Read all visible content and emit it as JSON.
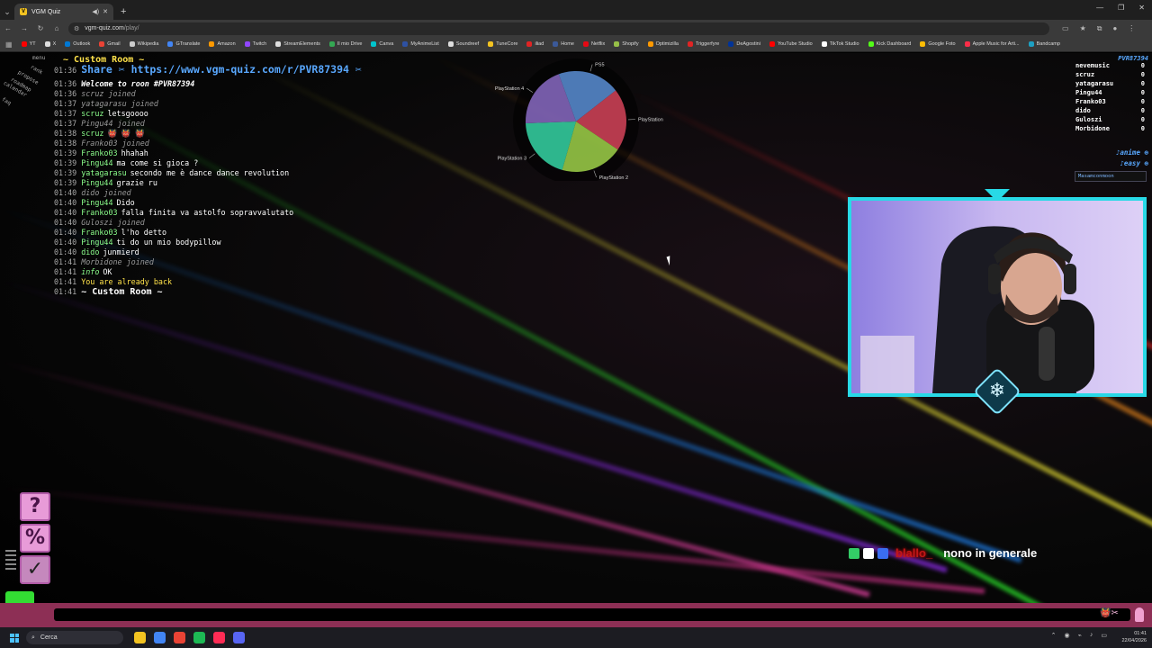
{
  "browser": {
    "tab_title": "VGM Quiz",
    "url_host": "vgm-quiz.com",
    "url_path": "/play/",
    "bookmarks": [
      {
        "label": "YT",
        "color": "#ff0000"
      },
      {
        "label": "X",
        "color": "#dddddd"
      },
      {
        "label": "Outlook",
        "color": "#0078d4"
      },
      {
        "label": "Gmail",
        "color": "#ea4335"
      },
      {
        "label": "Wikipedia",
        "color": "#cccccc"
      },
      {
        "label": "GTranslate",
        "color": "#4285f4"
      },
      {
        "label": "Amazon",
        "color": "#ff9900"
      },
      {
        "label": "Twitch",
        "color": "#9146ff"
      },
      {
        "label": "StreamElements",
        "color": "#dddddd"
      },
      {
        "label": "Il mio Drive",
        "color": "#34a853"
      },
      {
        "label": "Canva",
        "color": "#00c4cc"
      },
      {
        "label": "MyAnimeList",
        "color": "#2e51a2"
      },
      {
        "label": "Soundreef",
        "color": "#dddddd"
      },
      {
        "label": "TuneCore",
        "color": "#f3c321"
      },
      {
        "label": "iliad",
        "color": "#e02424"
      },
      {
        "label": "Home",
        "color": "#3b5998"
      },
      {
        "label": "Netflix",
        "color": "#e50914"
      },
      {
        "label": "Shopify",
        "color": "#96bf48"
      },
      {
        "label": "Optimizilla",
        "color": "#ff9900"
      },
      {
        "label": "Triggerfyre",
        "color": "#e02424"
      },
      {
        "label": "DeAgostini",
        "color": "#003399"
      },
      {
        "label": "YouTube Studio",
        "color": "#ff0000"
      },
      {
        "label": "TikTok Studio",
        "color": "#ffffff"
      },
      {
        "label": "Kick Dashboard",
        "color": "#53fc18"
      },
      {
        "label": "Google Foto",
        "color": "#fbbc05"
      },
      {
        "label": "Apple Music for Arti...",
        "color": "#fa2d48"
      },
      {
        "label": "Bandcamp",
        "color": "#1da0c3"
      }
    ]
  },
  "sidebar_rot": [
    "menu",
    "rank",
    "propose",
    "roadmap",
    "calendar",
    "faq"
  ],
  "chat": {
    "header": "~ Custom Room ~",
    "share_time": "01:36",
    "share_text": "Share ✂ https://www.vgm-quiz.com/r/PVR87394 ✂",
    "lines": [
      {
        "time": "01:36",
        "kind": "welcome",
        "user": "",
        "text": "Welcome to roon #PVR87394"
      },
      {
        "time": "01:36",
        "kind": "joined",
        "user": "",
        "text": "scruz joined"
      },
      {
        "time": "01:37",
        "kind": "joined",
        "user": "",
        "text": "yatagarasu joined"
      },
      {
        "time": "01:37",
        "kind": "msg",
        "user": "scruz",
        "text": "letsgoooo"
      },
      {
        "time": "01:37",
        "kind": "joined",
        "user": "",
        "text": "Pingu44 joined"
      },
      {
        "time": "01:38",
        "kind": "msg",
        "user": "scruz",
        "text": "👹 👹 👹"
      },
      {
        "time": "01:38",
        "kind": "joined",
        "user": "",
        "text": "Franko03 joined"
      },
      {
        "time": "01:39",
        "kind": "msg",
        "user": "Franko03",
        "text": "hhahah"
      },
      {
        "time": "01:39",
        "kind": "msg",
        "user": "Pingu44",
        "text": "ma come si gioca ?"
      },
      {
        "time": "01:39",
        "kind": "msg",
        "user": "yatagarasu",
        "text": "secondo me è dance dance revolution"
      },
      {
        "time": "01:39",
        "kind": "msg",
        "user": "Pingu44",
        "text": "grazie ru"
      },
      {
        "time": "01:40",
        "kind": "joined",
        "user": "",
        "text": "dido joined"
      },
      {
        "time": "01:40",
        "kind": "msg",
        "user": "Pingu44",
        "text": "Dido"
      },
      {
        "time": "01:40",
        "kind": "msg",
        "user": "Franko03",
        "text": "falla finita va astolfo sopravvalutato"
      },
      {
        "time": "01:40",
        "kind": "joined",
        "user": "",
        "text": "Guloszi joined"
      },
      {
        "time": "01:40",
        "kind": "msg",
        "user": "Franko03",
        "text": "l'ho detto"
      },
      {
        "time": "01:40",
        "kind": "msg",
        "user": "Pingu44",
        "text": "ti do un mio bodypillow"
      },
      {
        "time": "01:40",
        "kind": "msg",
        "user": "dido",
        "text": "junmierd"
      },
      {
        "time": "01:41",
        "kind": "joined",
        "user": "",
        "text": "Morbidone joined"
      },
      {
        "time": "01:41",
        "kind": "info",
        "user": "info",
        "text": "OK"
      },
      {
        "time": "01:41",
        "kind": "yellow",
        "user": "",
        "text": "You are already back"
      },
      {
        "time": "01:41",
        "kind": "room",
        "user": "",
        "text": "~ Custom Room ~"
      }
    ]
  },
  "chart_data": {
    "type": "pie",
    "categories": [
      "PS5",
      "PlayStation",
      "PlayStation 2",
      "PlayStation 3",
      "PlayStation 4"
    ],
    "values": [
      20,
      20,
      20,
      20,
      20
    ],
    "colors": [
      "#5b8fd6",
      "#d6445a",
      "#9fd24a",
      "#36d6a6",
      "#8a6bc4"
    ]
  },
  "players": {
    "room_code": "PVR87394",
    "list": [
      {
        "name": "nevemusic",
        "score": "0"
      },
      {
        "name": "scruz",
        "score": "0"
      },
      {
        "name": "yatagarasu",
        "score": "0"
      },
      {
        "name": "Pingu44",
        "score": "0"
      },
      {
        "name": "Franko03",
        "score": "0"
      },
      {
        "name": "dido",
        "score": "0"
      },
      {
        "name": "Guloszi",
        "score": "0"
      },
      {
        "name": "Morbidone",
        "score": "0"
      }
    ],
    "tag1": "♪anime ⊕",
    "tag2": "♪easy ⊕",
    "pill": "Masamconmoon"
  },
  "twitch_chat": {
    "user": "blallo_",
    "message": "nono in generale",
    "badge_colors": [
      "#33cc66",
      "#ffffff",
      "#3a6df0"
    ]
  },
  "tools": [
    "?",
    "%",
    "✓"
  ],
  "taskbar": {
    "search_placeholder": "Cerca",
    "time": "01:41",
    "date": "22/04/2026",
    "icon_colors": [
      "#f3c321",
      "#4285f4",
      "#ea4335",
      "#1db954",
      "#fe2c55",
      "#5865f2"
    ]
  }
}
